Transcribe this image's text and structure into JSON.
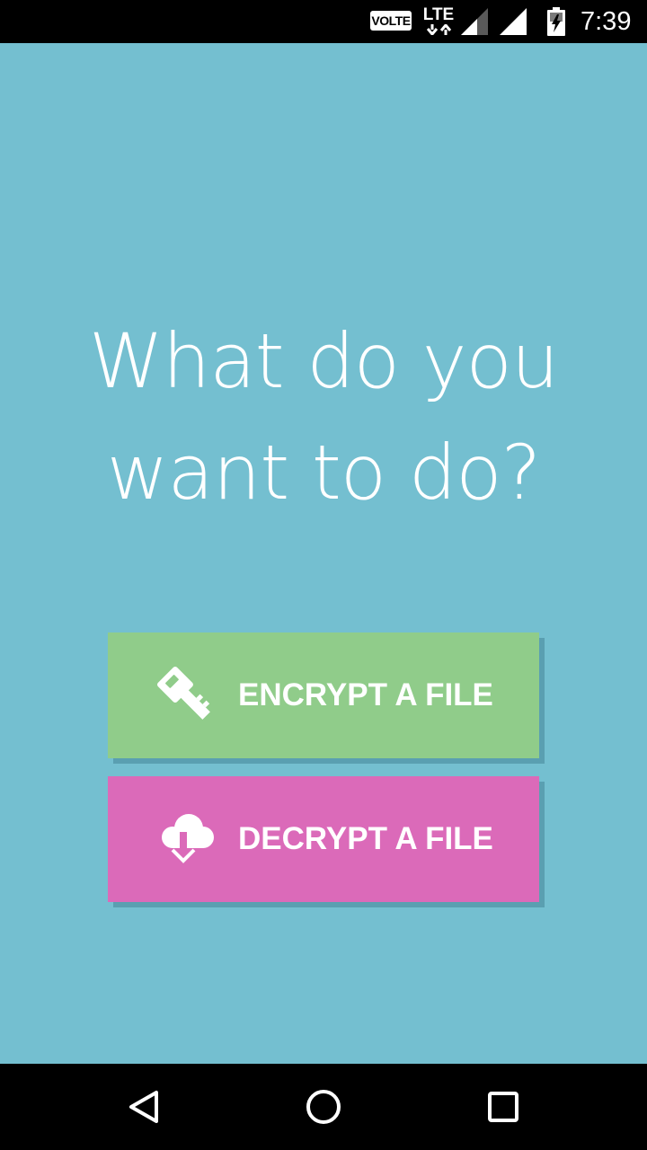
{
  "status_bar": {
    "volte": "VOLTE",
    "network": "LTE",
    "time": "7:39",
    "icons": [
      "signal-icon",
      "signal-icon",
      "battery-charging-icon"
    ]
  },
  "main": {
    "prompt": "What do you want to do?",
    "buttons": [
      {
        "label": "ENCRYPT A FILE",
        "icon": "key-icon",
        "color": "#90cc8a"
      },
      {
        "label": "DECRYPT A FILE",
        "icon": "cloud-download-icon",
        "color": "#db6ab9"
      }
    ],
    "background_color": "#74bfd0"
  },
  "nav_bar": {
    "icons": [
      "back-icon",
      "home-icon",
      "recents-icon"
    ]
  }
}
